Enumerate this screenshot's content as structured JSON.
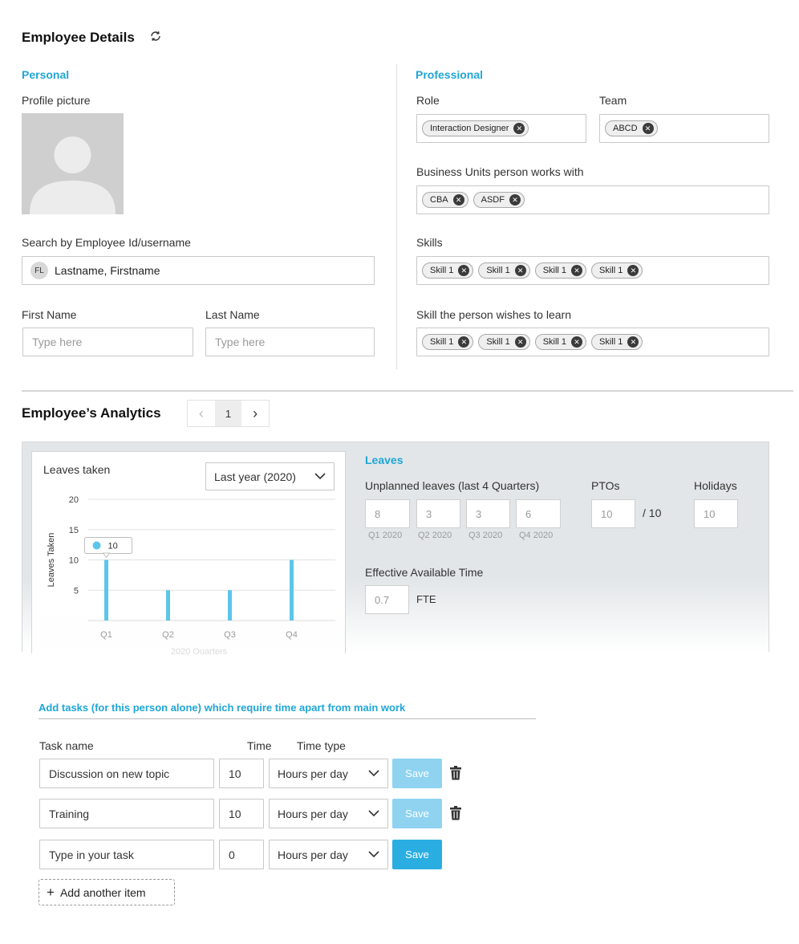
{
  "header": {
    "title": "Employee Details",
    "refresh_icon": "refresh-icon"
  },
  "personal": {
    "section_title": "Personal",
    "profile_label": "Profile picture",
    "search_label": "Search by Employee Id/username",
    "search_initials": "FL",
    "search_value": "Lastname, Firstname",
    "first_name_label": "First Name",
    "first_name_placeholder": "Type here",
    "last_name_label": "Last Name",
    "last_name_placeholder": "Type here"
  },
  "professional": {
    "section_title": "Professional",
    "role_label": "Role",
    "role_chips": [
      "Interaction Designer"
    ],
    "team_label": "Team",
    "team_chips": [
      "ABCD"
    ],
    "bu_label": "Business Units person works with",
    "bu_chips": [
      "CBA",
      "ASDF"
    ],
    "skills_label": "Skills",
    "skills_chips": [
      "Skill 1",
      "Skill 1",
      "Skill 1",
      "Skill 1"
    ],
    "wish_label": "Skill the person wishes to learn",
    "wish_chips": [
      "Skill 1",
      "Skill 1",
      "Skill 1",
      "Skill 1"
    ]
  },
  "analytics": {
    "title": "Employee’s Analytics",
    "prev": "‹",
    "page": "1",
    "next": "›"
  },
  "chart_data": {
    "type": "bar",
    "title": "Leaves taken",
    "ylabel": "Leaves Taken",
    "xlabel": "2020 Quarters",
    "categories": [
      "Q1",
      "Q2",
      "Q3",
      "Q4"
    ],
    "values": [
      10,
      5,
      5,
      10
    ],
    "yticks": [
      "20",
      "15",
      "10",
      "5"
    ],
    "ylim": [
      0,
      20
    ],
    "grid": true,
    "tooltip": "10",
    "bar_color": "#5bc6ea",
    "period_select": "Last year (2020)"
  },
  "leaves": {
    "title": "Leaves",
    "unplanned_label": "Unplanned leaves (last 4 Quarters)",
    "unplanned": [
      {
        "value": "8",
        "quarter": "Q1 2020"
      },
      {
        "value": "3",
        "quarter": "Q2 2020"
      },
      {
        "value": "3",
        "quarter": "Q3 2020"
      },
      {
        "value": "6",
        "quarter": "Q4 2020"
      }
    ],
    "pto_label": "PTOs",
    "pto_value": "10",
    "pto_total": "/ 10",
    "holidays_label": "Holidays",
    "holidays_value": "10",
    "eat_label": "Effective Available Time",
    "eat_value": "0.7",
    "eat_unit": "FTE"
  },
  "tasks": {
    "title": "Add tasks (for this person alone) which require time apart from main work",
    "col_task": "Task name",
    "col_time": "Time",
    "col_type": "Time type",
    "rows": [
      {
        "name": "Discussion on new topic",
        "time": "10",
        "type": "Hours per day",
        "save": "Save"
      },
      {
        "name": "Training",
        "time": "10",
        "type": "Hours per day",
        "save": "Save"
      },
      {
        "name": "Type in your task",
        "time": "0",
        "type": "Hours per day",
        "save": "Save"
      }
    ],
    "add_label": "Add another item"
  },
  "colors": {
    "accent": "#1fa6d6",
    "save_active": "#2aaee2",
    "save_disabled": "#8fd3f1"
  }
}
